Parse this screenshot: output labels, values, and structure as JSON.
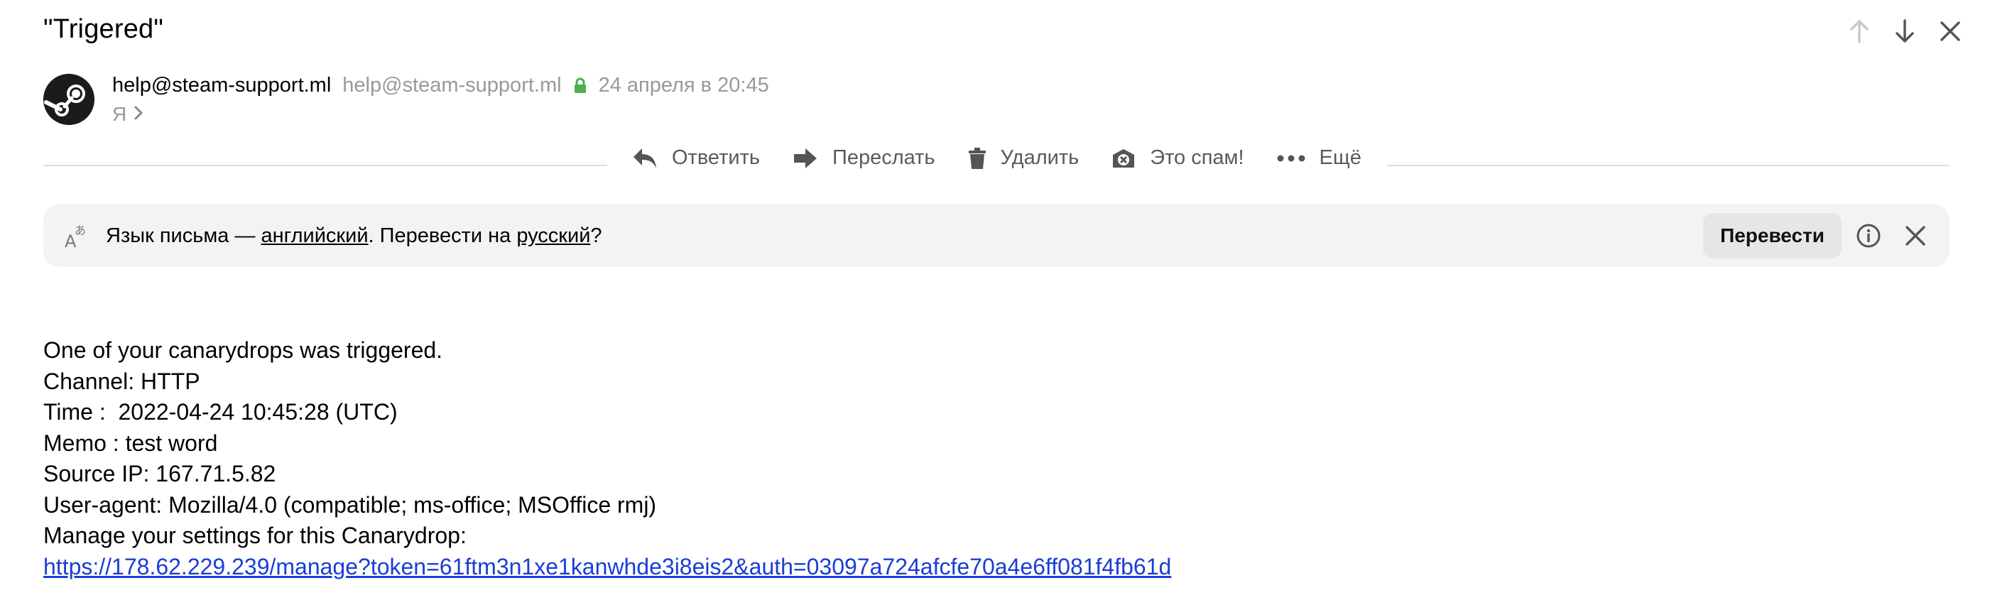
{
  "message": {
    "subject": "\"Trigered\"",
    "from_name": "help@steam-support.ml",
    "from_email": "help@steam-support.ml",
    "date": "24 апреля в 20:45",
    "to": "Я"
  },
  "toolbar": {
    "reply": "Ответить",
    "forward": "Переслать",
    "delete": "Удалить",
    "spam": "Это спам!",
    "more": "Ещё"
  },
  "translate": {
    "prefix": "Язык письма — ",
    "lang_from": "английский",
    "middle": ". Перевести на ",
    "lang_to": "русский",
    "suffix": "?",
    "button": "Перевести"
  },
  "body": {
    "line1": "One of your canarydrops was triggered.",
    "line2": "Channel: HTTP",
    "line3": "Time :  2022-04-24 10:45:28 (UTC)",
    "line4": "Memo : test word",
    "line5": "Source IP: 167.71.5.82",
    "line6": "User-agent: Mozilla/4.0 (compatible; ms-office; MSOffice rmj)",
    "line7": "Manage your settings for this Canarydrop:",
    "link": "https://178.62.229.239/manage?token=61ftm3n1xe1kanwhde3i8eis2&auth=03097a724afcfe70a4e6ff081f4fb61d"
  },
  "icons": {
    "prev": "arrow-up-icon",
    "next": "arrow-down-icon",
    "close": "close-icon",
    "avatar": "steam-logo",
    "lock": "lock-icon",
    "reply": "reply-icon",
    "forward": "forward-icon",
    "delete": "trash-icon",
    "spam": "spam-icon",
    "more": "more-dots-icon",
    "translate": "translate-icon",
    "info": "info-icon"
  },
  "colors": {
    "lock_green": "#4caf50",
    "link": "#1a3dd6",
    "muted": "#999999"
  }
}
